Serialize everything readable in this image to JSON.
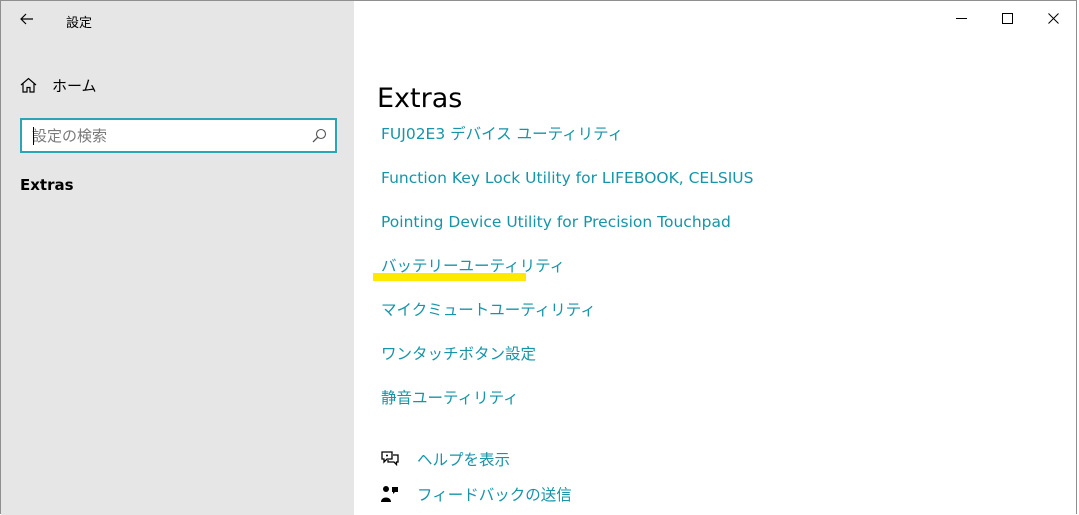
{
  "window": {
    "title": "設定"
  },
  "sidebar": {
    "home_label": "ホーム",
    "search": {
      "placeholder": "設定の検索",
      "value": ""
    },
    "current_section": "Extras"
  },
  "main": {
    "title": "Extras",
    "links": [
      "FUJ02E3 デバイス ユーティリティ",
      "Function Key Lock Utility for LIFEBOOK, CELSIUS",
      "Pointing Device Utility for Precision Touchpad",
      "バッテリーユーティリティ",
      "マイクミュートユーティリティ",
      "ワンタッチボタン設定",
      "静音ユーティリティ"
    ],
    "help": {
      "show_help": "ヘルプを表示",
      "feedback": "フィードバックの送信"
    }
  },
  "colors": {
    "accent": "#1695a9",
    "search_border": "#2aa5b5",
    "sidebar_bg": "#e6e6e6",
    "highlight": "#ffe900"
  },
  "icons": {
    "back": "back-arrow-icon",
    "home": "home-icon",
    "search": "search-icon",
    "minimize": "minimize-icon",
    "maximize": "maximize-icon",
    "close": "close-icon",
    "help": "help-chat-icon",
    "feedback": "feedback-person-icon"
  }
}
